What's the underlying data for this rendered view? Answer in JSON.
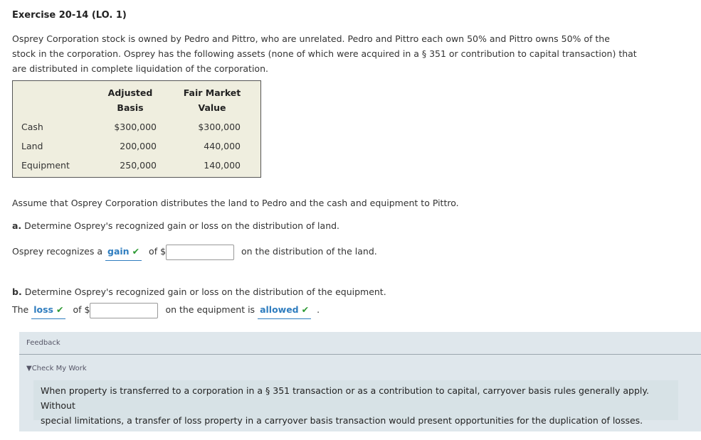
{
  "exercise": {
    "title": "Exercise 20-14 (LO. 1)"
  },
  "intro": {
    "line1": "Osprey Corporation stock is owned by Pedro and Pittro, who are unrelated. Pedro and Pittro each own 50% and Pittro owns 50% of the",
    "line2": "stock in the corporation. Osprey has the following assets (none of which were acquired in a § 351 or contribution to capital transaction) that",
    "line3": "are distributed in complete liquidation of the corporation."
  },
  "assets_table": {
    "col1_line1": "Adjusted",
    "col1_line2": "Basis",
    "col2_line1": "Fair Market",
    "col2_line2": "Value",
    "rows": [
      {
        "asset": "Cash",
        "basis": "$300,000",
        "fmv": "$300,000"
      },
      {
        "asset": "Land",
        "basis": "200,000",
        "fmv": "440,000"
      },
      {
        "asset": "Equipment",
        "basis": "250,000",
        "fmv": "140,000"
      }
    ]
  },
  "assumption": "Assume that Osprey Corporation distributes the land to Pedro and the cash and equipment to Pittro.",
  "part_a": {
    "letter": "a.",
    "question": "Determine Osprey's recognized gain or loss on the distribution of land.",
    "answer_prefix": "Osprey recognizes a",
    "selection": "gain",
    "of_label": "of $",
    "input_value": "",
    "answer_suffix": "on the distribution of the land."
  },
  "part_b": {
    "letter": "b.",
    "question": "Determine Osprey's recognized gain or loss on the distribution of the equipment.",
    "answer_prefix": "The",
    "selection1": "loss",
    "of_label": "of $",
    "input_value": "",
    "middle_text": "on the equipment is",
    "selection2": "allowed",
    "end": "."
  },
  "feedback": {
    "label": "Feedback",
    "toggle_label": "Check My Work",
    "text_line1": "When property is transferred to a corporation in a § 351 transaction or as a contribution to capital, carryover basis rules generally apply. Without",
    "text_line2": "special limitations, a transfer of loss property in a carryover basis transaction would present opportunities for the duplication of losses."
  },
  "icons": {
    "check": "check-icon",
    "triangle": "triangle-down-icon"
  },
  "colors": {
    "selection": "#2f7dbf",
    "check": "#2e9a34",
    "table_bg": "#efeedf",
    "feedback_bg": "#dfe7ec"
  }
}
